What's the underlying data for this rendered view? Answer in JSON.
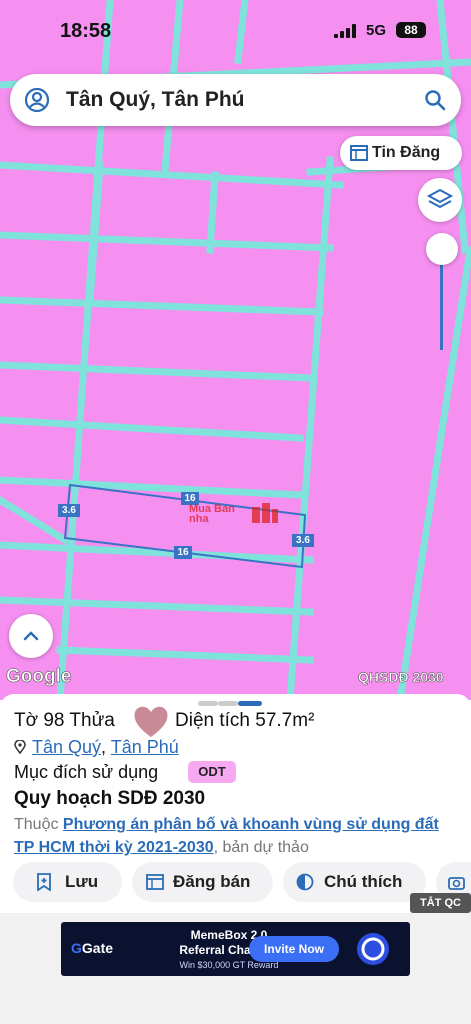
{
  "status": {
    "time": "18:58",
    "network": "5G",
    "battery": "88"
  },
  "search": {
    "query": "Tân Quý, Tân Phú"
  },
  "map": {
    "tin_dang_label": "Tin Đăng",
    "edge_labels": [
      "16",
      "16",
      "3.6",
      "3.6"
    ],
    "watermark_brand": "Mua Ban nha",
    "google_label": "Google",
    "layer_label": "QHSDĐ 2030"
  },
  "panel": {
    "to_label": "Tờ 98 Thửa",
    "area_label": "Diện tích 57.7m²",
    "ward_link": "Tân Quý",
    "separator": ",",
    "district_link": "Tân Phú",
    "purpose_label": "Mục đích sử dụng",
    "purpose_badge": "ODT",
    "plan_title": "Quy hoạch SDĐ 2030",
    "plan_prefix": "Thuộc",
    "plan_link": "Phương án phân bố và khoanh vùng sử dụng đất TP HCM thời kỳ 2021-2030",
    "plan_suffix": ", bản dự thảo",
    "buttons": [
      "Lưu",
      "Đăng bán",
      "Chú thích"
    ]
  },
  "ad": {
    "close_label": "TẮT QC",
    "brand": "Gate",
    "line1": "MemeBox 2.0",
    "line2": "Referral Challnge",
    "line3": "Win $30,000 GT Reward",
    "cta": "Invite Now"
  },
  "colors": {
    "parcel_fill": "#f58ff0",
    "road": "#7fe3dc",
    "accent": "#2b6cb8"
  }
}
